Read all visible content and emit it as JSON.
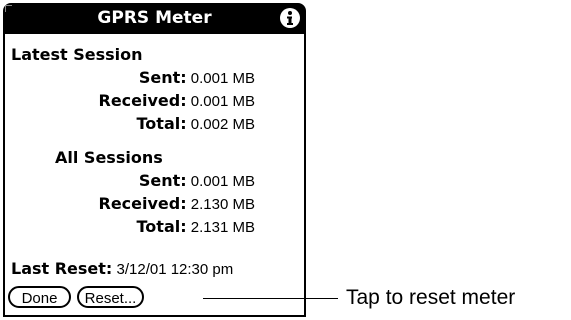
{
  "app": {
    "title": "GPRS Meter",
    "info_icon": "info-icon"
  },
  "latest_session": {
    "heading": "Latest Session",
    "sent_label": "Sent:",
    "sent_value": " 0.001 MB",
    "received_label": "Received:",
    "received_value": " 0.001 MB",
    "total_label": "Total:",
    "total_value": " 0.002 MB"
  },
  "all_sessions": {
    "heading": "All Sessions",
    "sent_label": "Sent:",
    "sent_value": " 0.001 MB",
    "received_label": "Received:",
    "received_value": " 2.130 MB",
    "total_label": "Total:",
    "total_value": " 2.131 MB"
  },
  "last_reset": {
    "label": "Last Reset:",
    "value": " 3/12/01 12:30 pm"
  },
  "buttons": {
    "done_label": "Done",
    "reset_label": "Reset..."
  },
  "callout": {
    "text": "Tap to reset meter"
  }
}
